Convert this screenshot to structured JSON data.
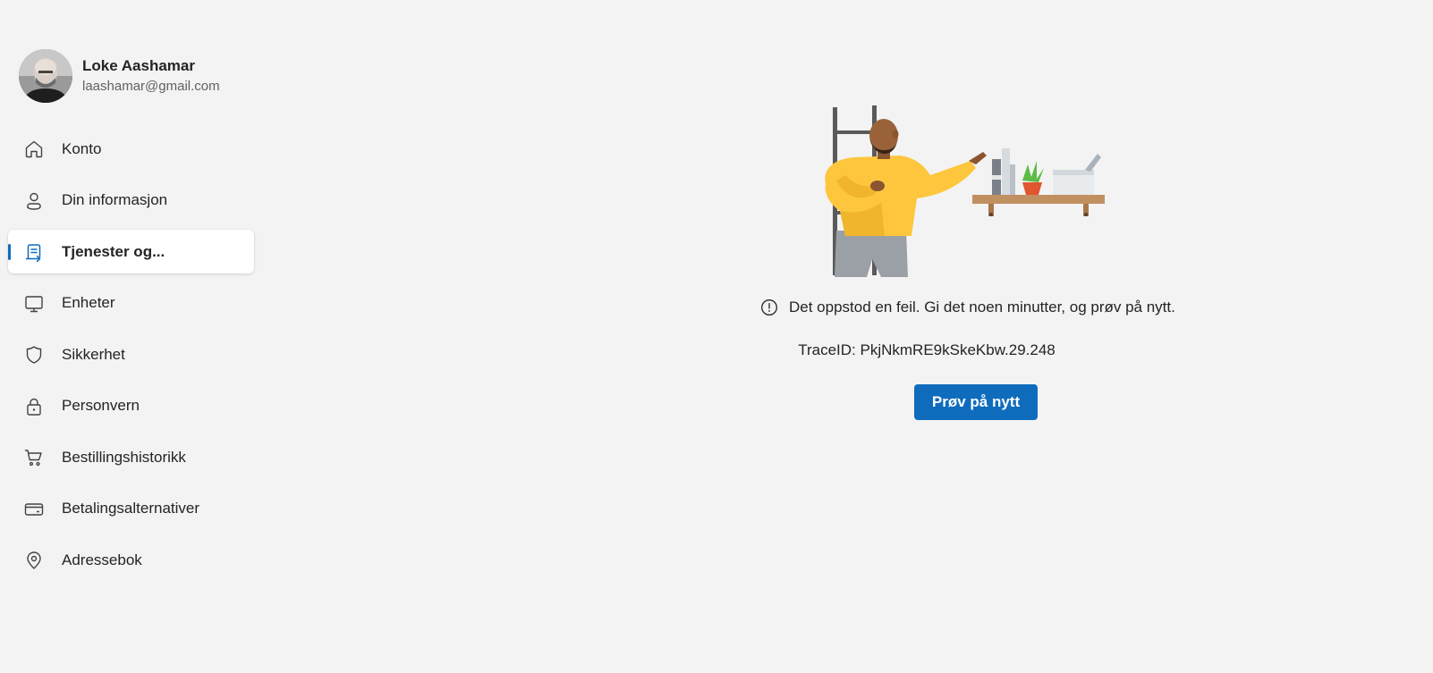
{
  "profile": {
    "name": "Loke Aashamar",
    "email": "laashamar@gmail.com"
  },
  "nav": {
    "items": [
      {
        "label": "Konto",
        "icon": "home-icon",
        "active": false
      },
      {
        "label": "Din informasjon",
        "icon": "person-icon",
        "active": false
      },
      {
        "label": "Tjenester og...",
        "icon": "subscriptions-icon",
        "active": true
      },
      {
        "label": "Enheter",
        "icon": "desktop-icon",
        "active": false
      },
      {
        "label": "Sikkerhet",
        "icon": "shield-icon",
        "active": false
      },
      {
        "label": "Personvern",
        "icon": "lock-icon",
        "active": false
      },
      {
        "label": "Bestillingshistorikk",
        "icon": "cart-icon",
        "active": false
      },
      {
        "label": "Betalingsalternativer",
        "icon": "credit-card-icon",
        "active": false
      },
      {
        "label": "Adressebok",
        "icon": "location-pin-icon",
        "active": false
      }
    ]
  },
  "main": {
    "error_message": "Det oppstod en feil. Gi det noen minutter, og prøv på nytt.",
    "trace_id": "TraceID: PkjNkmRE9kSkeKbw.29.248",
    "retry_label": "Prøv på nytt"
  },
  "colors": {
    "accent": "#0f6cbd",
    "background": "#f3f3f3",
    "shirt": "#fec63d",
    "shelf": "#c09060"
  }
}
